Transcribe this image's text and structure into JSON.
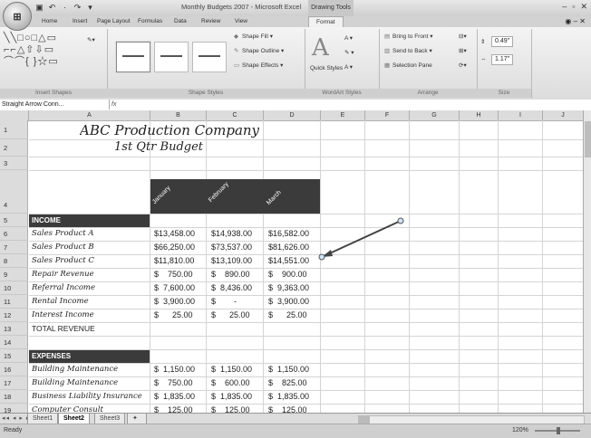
{
  "window": {
    "title": "Monthly Budgets 2007 - Microsoft Excel",
    "contextual_tab_group": "Drawing Tools",
    "office_button": "⊞"
  },
  "tabs": [
    "Home",
    "Insert",
    "Page Layout",
    "Formulas",
    "Data",
    "Review",
    "View"
  ],
  "active_tab": "Format",
  "ribbon": {
    "groups": {
      "insert_shapes": "Insert Shapes",
      "shape_styles": "Shape Styles",
      "wordart_styles": "WordArt Styles",
      "arrange": "Arrange",
      "size": "Size"
    },
    "shape_fill": "Shape Fill",
    "shape_outline": "Shape Outline",
    "shape_effects": "Shape Effects",
    "quick_styles": "Quick Styles",
    "bring_to_front": "Bring to Front",
    "send_to_back": "Send to Back",
    "selection_pane": "Selection Pane",
    "height": "0.49\"",
    "width": "1.17\""
  },
  "formula_bar": {
    "name_box": "Straight Arrow Conn...",
    "fx": "fx"
  },
  "columns": [
    "A",
    "B",
    "C",
    "D",
    "E",
    "F",
    "G",
    "H",
    "I",
    "J"
  ],
  "rows": [
    "1",
    "2",
    "3",
    "4",
    "5",
    "6",
    "7",
    "8",
    "9",
    "10",
    "11",
    "12",
    "13",
    "14",
    "15",
    "16",
    "17",
    "18",
    "19"
  ],
  "sheet": {
    "company": "ABC Production Company",
    "subtitle": "1st Qtr Budget",
    "months": [
      "January",
      "February",
      "March"
    ],
    "income_header": "INCOME",
    "income": [
      {
        "label": "Sales Product A",
        "jan": "$13,458.00",
        "feb": "$14,938.00",
        "mar": "$16,582.00"
      },
      {
        "label": "Sales Product B",
        "jan": "$66,250.00",
        "feb": "$73,537.00",
        "mar": "$81,626.00"
      },
      {
        "label": "Sales Product C",
        "jan": "$11,810.00",
        "feb": "$13,109.00",
        "mar": "$14,551.00"
      },
      {
        "label": "Repair Revenue",
        "jan": "$    750.00",
        "feb": "$    890.00",
        "mar": "$    900.00"
      },
      {
        "label": "Referral Income",
        "jan": "$  7,600.00",
        "feb": "$  8,436.00",
        "mar": "$  9,363.00"
      },
      {
        "label": "Rental Income",
        "jan": "$  3,900.00",
        "feb": "$        -",
        "mar": "$  3,900.00"
      },
      {
        "label": "Interest Income",
        "jan": "$      25.00",
        "feb": "$      25.00",
        "mar": "$      25.00"
      }
    ],
    "total_revenue": "TOTAL REVENUE",
    "expenses_header": "EXPENSES",
    "expenses": [
      {
        "label": "Building Maintenance",
        "jan": "$  1,150.00",
        "feb": "$  1,150.00",
        "mar": "$  1,150.00"
      },
      {
        "label": "Building Maintenance",
        "jan": "$    750.00",
        "feb": "$    600.00",
        "mar": "$    825.00"
      },
      {
        "label": "Business Liability Insurance",
        "jan": "$  1,835.00",
        "feb": "$  1,835.00",
        "mar": "$  1,835.00"
      },
      {
        "label": "Computer Consult",
        "jan": "$    125.00",
        "feb": "$    125.00",
        "mar": "$    125.00"
      }
    ]
  },
  "sheet_tabs": [
    "Sheet1",
    "Sheet2",
    "Sheet3"
  ],
  "active_sheet": "Sheet2",
  "status": {
    "ready": "Ready",
    "zoom": "120%"
  }
}
